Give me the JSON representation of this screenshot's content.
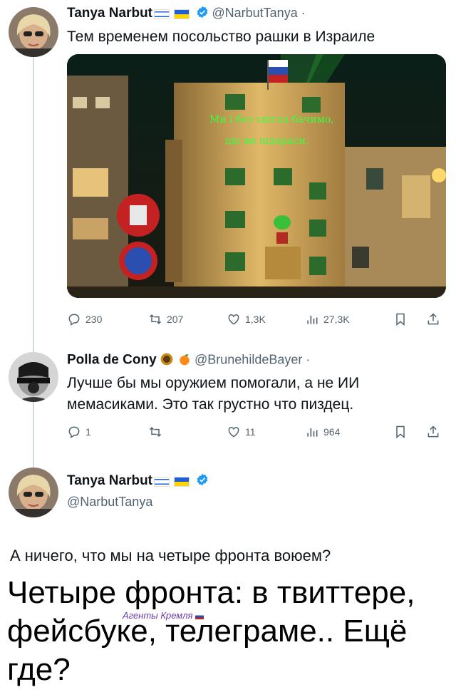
{
  "tweet1": {
    "name": "Tanya Narbut",
    "handle": "@NarbutTanya ·",
    "text": "Тем временем посольство рашки в Израиле",
    "image_overlay_line1": "Ми і без світла бачимо,",
    "image_overlay_line2": "що ви підараси.",
    "stats": {
      "replies": "230",
      "reposts": "207",
      "likes": "1,3K",
      "views": "27,3K"
    }
  },
  "tweet2": {
    "name": "Polla de Cony",
    "handle": "@BrunehildeBayer ·",
    "text_line1": "Лучше бы мы оружием помогали, а не ИИ",
    "text_line2": "мемасиками. Это так грустно что пиздец.",
    "stats": {
      "replies": "1",
      "reposts": "",
      "likes": "11",
      "views": "964"
    }
  },
  "tweet3": {
    "name": "Tanya Narbut",
    "handle": "@NarbutTanya",
    "text": "А ничего, что мы на четыре фронта воюем?"
  },
  "caption": {
    "line1": "Четыре фронта: в твиттере,",
    "line2": "фейсбуке, телеграме.. Ещё",
    "line3": "где?",
    "watermark": "Агенты Кремля"
  },
  "icons": [
    "reply-icon",
    "repost-icon",
    "like-icon",
    "views-icon",
    "bookmark-icon",
    "share-icon",
    "verified-badge-icon",
    "israel-flag-icon",
    "ukraine-flag-icon",
    "peach-emoji-icon",
    "badge-emoji-icon"
  ],
  "colors": {
    "verified": "#1d9bf0",
    "text": "#0f1419",
    "muted": "#536471",
    "laser": "#39ff3f"
  }
}
